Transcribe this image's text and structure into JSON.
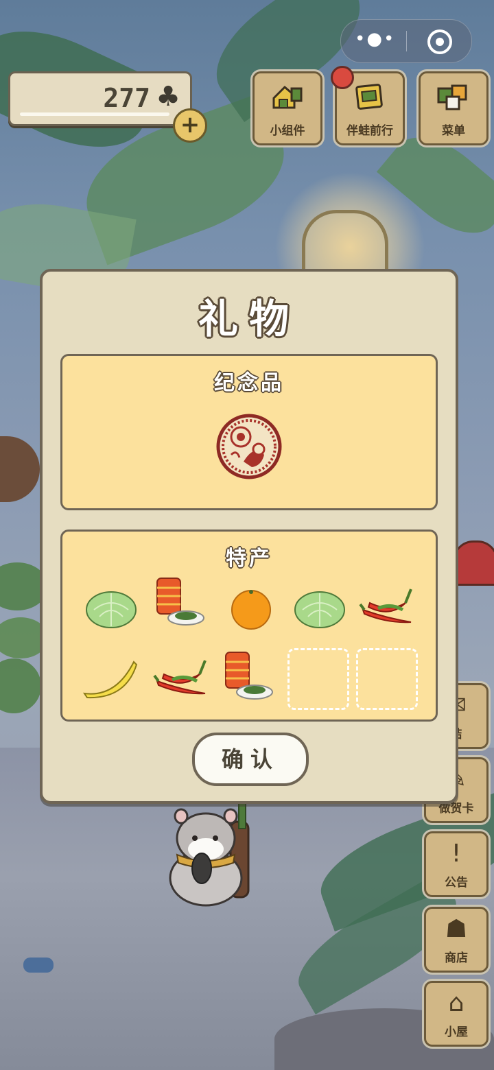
{
  "hud": {
    "clover_count": "277",
    "clover_icon": "clover-icon",
    "plus_icon": "plus-icon",
    "top_buttons": [
      {
        "label": "小组件",
        "icon": "widget-icon"
      },
      {
        "label": "伴蛙前行",
        "icon": "frog-journey-icon"
      },
      {
        "label": "菜单",
        "icon": "menu-cards-icon"
      }
    ],
    "side_buttons": [
      {
        "label": "结",
        "icon": "letter-icon"
      },
      {
        "label": "做贺卡",
        "icon": "greeting-card-icon"
      },
      {
        "label": "公告",
        "icon": "exclamation-icon"
      },
      {
        "label": "商店",
        "icon": "shop-bag-icon"
      },
      {
        "label": "小屋",
        "icon": "house-icon"
      }
    ]
  },
  "dialog": {
    "title": "礼物",
    "souvenir": {
      "title": "纪念品",
      "item": "paper-cut-medallion-icon"
    },
    "specialty": {
      "title": "特产",
      "items": [
        "cabbage-icon",
        "canned-food-icon",
        "orange-icon",
        "cabbage-icon",
        "chili-pepper-icon",
        "banana-icon",
        "chili-pepper-icon",
        "canned-food-icon",
        "empty-slot",
        "empty-slot"
      ]
    },
    "confirm_label": "确认"
  },
  "colors": {
    "dialog_bg": "#e6ddc1",
    "panel_bg": "#fce19d",
    "outline": "#6f6555",
    "button_wood": "#d1b786"
  }
}
